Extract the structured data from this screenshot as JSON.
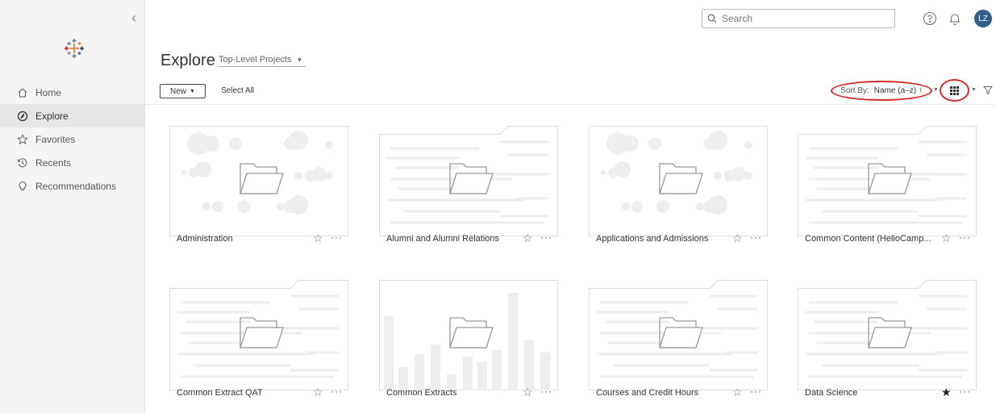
{
  "sidebar": {
    "items": [
      {
        "label": "Home",
        "icon": "home-icon",
        "active": false
      },
      {
        "label": "Explore",
        "icon": "compass-icon",
        "active": true
      },
      {
        "label": "Favorites",
        "icon": "star-icon",
        "active": false
      },
      {
        "label": "Recents",
        "icon": "history-icon",
        "active": false
      },
      {
        "label": "Recommendations",
        "icon": "lightbulb-icon",
        "active": false
      }
    ]
  },
  "topbar": {
    "search_placeholder": "Search",
    "avatar_initials": "LZ"
  },
  "page": {
    "title": "Explore",
    "project_filter": "Top-Level Projects"
  },
  "toolbar": {
    "new_label": "New",
    "select_all_label": "Select All",
    "sort_label": "Sort By:",
    "sort_value": "Name (a–z) ↑"
  },
  "projects": [
    {
      "name": "Administration",
      "thumb": "circles",
      "favorite": false
    },
    {
      "name": "Alumni and Alumni Relations",
      "thumb": "lines",
      "favorite": false
    },
    {
      "name": "Applications and Admissions",
      "thumb": "circles",
      "favorite": false
    },
    {
      "name": "Common Content (HelioCamp...",
      "thumb": "lines",
      "favorite": false
    },
    {
      "name": "Common Extract QAT",
      "thumb": "lines",
      "favorite": false
    },
    {
      "name": "Common Extracts",
      "thumb": "bars",
      "favorite": false
    },
    {
      "name": "Courses and Credit Hours",
      "thumb": "lines",
      "favorite": false
    },
    {
      "name": "Data Science",
      "thumb": "lines",
      "favorite": true
    }
  ],
  "colors": {
    "highlight": "#d52b2b",
    "avatar": "#2f5f8a",
    "sidebar_bg": "#f5f5f5"
  }
}
